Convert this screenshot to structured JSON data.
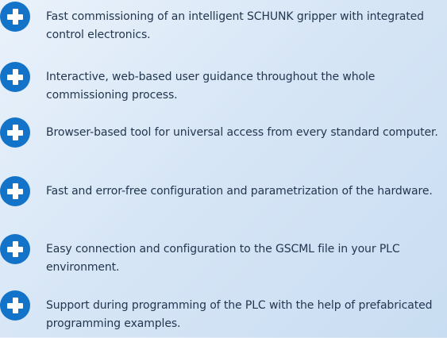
{
  "features": [
    {
      "icon": "plus-circle-icon",
      "text": "Fast commissioning of an intelligent SCHUNK gripper with integrated control electronics."
    },
    {
      "icon": "plus-circle-icon",
      "text": "Interactive, web-based user guidance throughout the whole commissioning process."
    },
    {
      "icon": "plus-circle-icon",
      "text": "Browser-based tool for universal access from every standard computer."
    },
    {
      "icon": "plus-circle-icon",
      "text": "Fast and error-free configuration and parametrization of the hardware."
    },
    {
      "icon": "plus-circle-icon",
      "text": "Easy connection and configuration to the GSCML file in your PLC environment."
    },
    {
      "icon": "plus-circle-icon",
      "text": "Support during programming of the PLC with the help of prefabricated programming examples."
    }
  ],
  "colors": {
    "icon": "#1273c8",
    "text": "#22364f",
    "background": "#d7e6f6"
  }
}
